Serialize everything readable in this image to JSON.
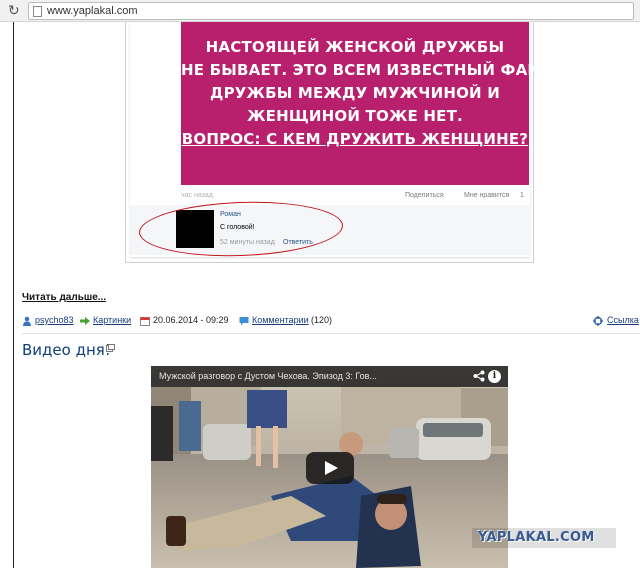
{
  "browser": {
    "url": "www.yaplakal.com",
    "reload_icon": "reload-icon",
    "page_icon": "page-icon"
  },
  "post_image": {
    "meme_lines": [
      "НАСТОЯЩЕЙ ЖЕНСКОЙ ДРУЖБЫ",
      "НЕ БЫВАЕТ. ЭТО ВСЕМ ИЗВЕСТНЫЙ ФАКТ.",
      "ДРУЖБЫ МЕЖДУ МУЖЧИНОЙ И",
      "ЖЕНЩИНОЙ ТОЖЕ НЕТ.",
      "ВОПРОС: С КЕМ ДРУЖИТЬ ЖЕНЩИНЕ?"
    ],
    "meme_color": "#b8206d",
    "time_label": "час назад",
    "share_label": "Поделиться",
    "like_label": "Мне нравится",
    "like_count": "1",
    "comment": {
      "author": "Роман",
      "text": "С головой!",
      "time": "52 минуты назад",
      "reply": "Ответить"
    },
    "highlight_color": "#c0151b"
  },
  "article": {
    "read_more": "Читать дальше...",
    "author": "psycho83",
    "category": "Картинки",
    "date": "20.06.2014 - 09:29",
    "comments_label": "Комментарии",
    "comments_count": "(120)",
    "link_label": "Ссылка",
    "link_color": "#1a3d7a"
  },
  "video_section": {
    "heading": "Видео дня!",
    "video_title": "Мужской разговор с Дустом Чехова. Эпизод 3: Гов...",
    "share_icon": "share-icon",
    "info_icon": "info-icon",
    "play_icon": "play-icon"
  },
  "watermark": "YAPLAKAL.COM"
}
